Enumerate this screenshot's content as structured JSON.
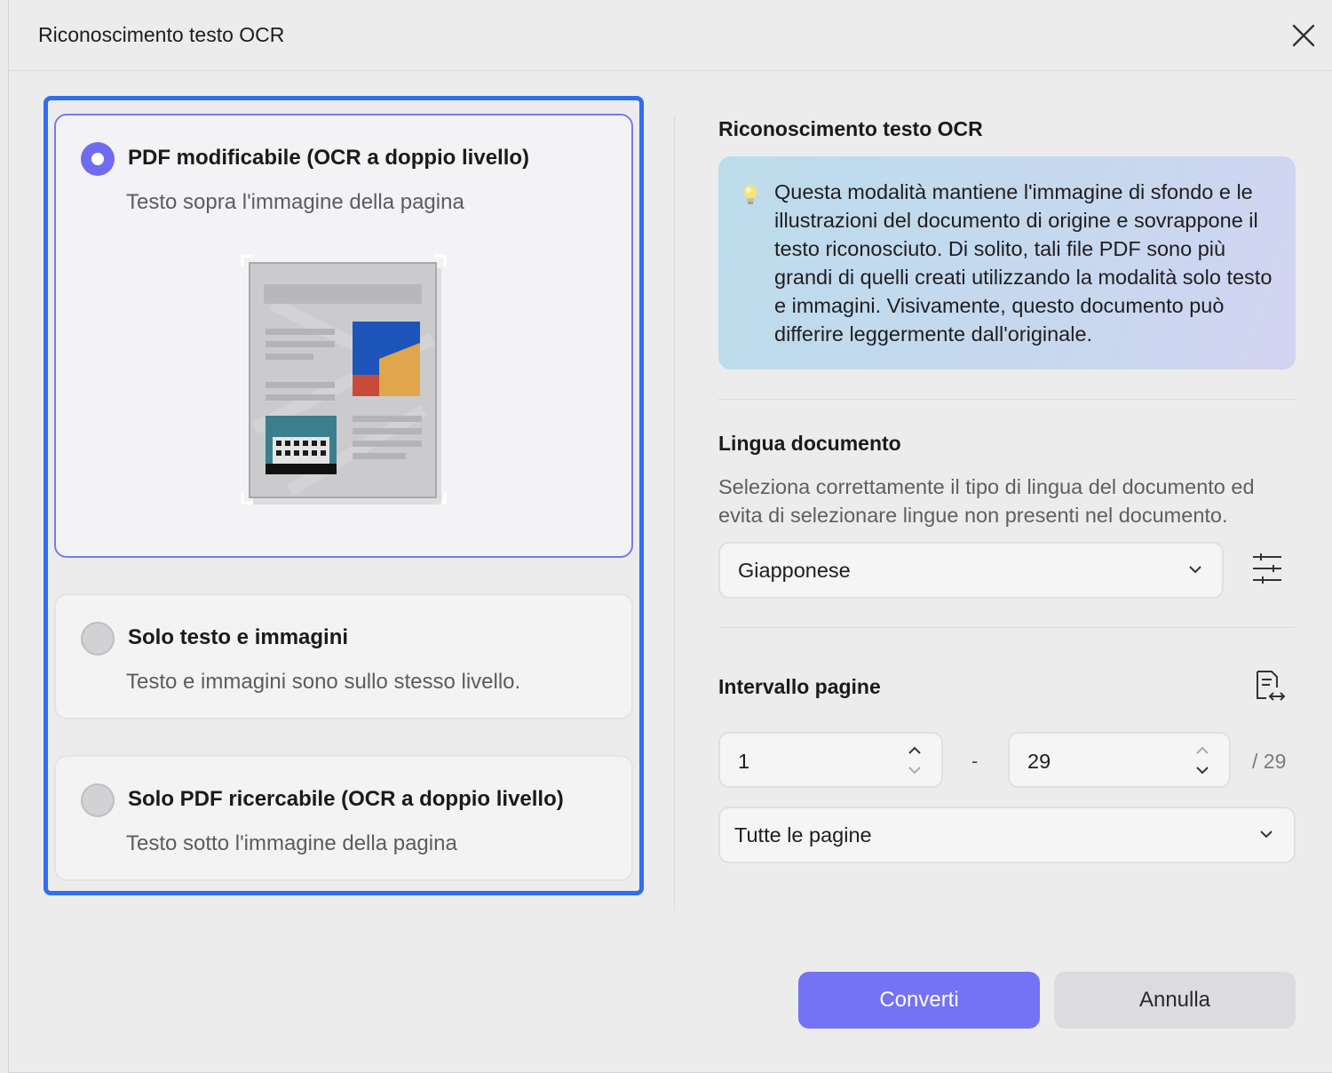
{
  "window": {
    "title": "Riconoscimento testo OCR"
  },
  "modes": [
    {
      "title": "PDF modificabile (OCR a doppio livello)",
      "description": "Testo sopra l'immagine della pagina",
      "selected": true
    },
    {
      "title": "Solo testo e immagini",
      "description": "Testo e immagini sono sullo stesso livello.",
      "selected": false
    },
    {
      "title": "Solo PDF ricercabile (OCR a doppio livello)",
      "description": "Testo sotto l'immagine della pagina",
      "selected": false
    }
  ],
  "ocr_info": {
    "title": "Riconoscimento testo OCR",
    "text": "Questa modalità mantiene l'immagine di sfondo e le illustrazioni del documento di origine e sovrappone il testo riconosciuto. Di solito, tali file PDF sono più grandi di quelli creati utilizzando la modalità solo testo e immagini. Visivamente, questo documento può differire leggermente dall'originale.",
    "icon": "lightbulb-icon"
  },
  "language": {
    "title": "Lingua documento",
    "description": "Seleziona correttamente il tipo di lingua del documento ed evita di selezionare lingue non presenti nel documento.",
    "selected": "Giapponese"
  },
  "page_range": {
    "title": "Intervallo pagine",
    "from": "1",
    "separator": "-",
    "to": "29",
    "total": "/ 29",
    "subset": "Tutte le pagine"
  },
  "buttons": {
    "convert": "Converti",
    "cancel": "Annulla"
  },
  "colors": {
    "accent": "#7473f6",
    "selection_border": "#2f6ff0"
  }
}
